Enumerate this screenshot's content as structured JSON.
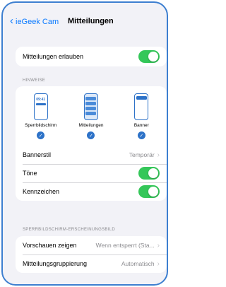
{
  "nav": {
    "back_label": "ieGeek Cam",
    "title": "Mitteilungen"
  },
  "allow": {
    "label": "Mitteilungen erlauben",
    "enabled": true
  },
  "alerts": {
    "header": "HINWEISE",
    "styles": [
      {
        "label": "Sperrbildschirm",
        "time": "09:41",
        "checked": true
      },
      {
        "label": "Mitteilungen",
        "checked": true
      },
      {
        "label": "Banner",
        "checked": true
      }
    ],
    "banner_style": {
      "label": "Bannerstil",
      "value": "Temporär"
    },
    "sounds": {
      "label": "Töne",
      "enabled": true
    },
    "badges": {
      "label": "Kennzeichen",
      "enabled": true
    }
  },
  "lockscreen": {
    "header": "SPERRBILDSCHIRM-ERSCHEINUNGSBILD",
    "previews": {
      "label": "Vorschauen zeigen",
      "value": "Wenn entsperrt (Sta..."
    },
    "grouping": {
      "label": "Mitteilungsgruppierung",
      "value": "Automatisch"
    }
  },
  "colors": {
    "accent": "#0a7aff",
    "toggle_on": "#34c759",
    "frame": "#3d7fd0"
  }
}
